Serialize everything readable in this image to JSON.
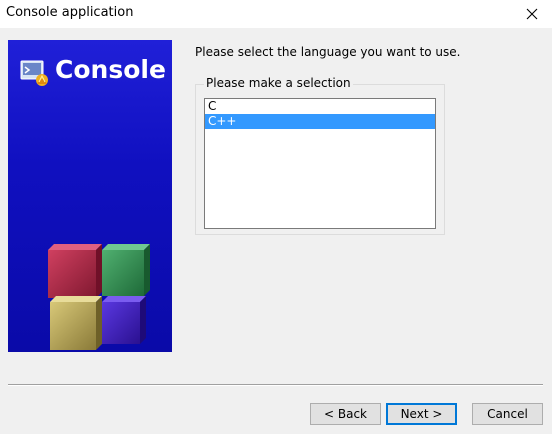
{
  "window": {
    "title": "Console application"
  },
  "banner": {
    "title": "Console",
    "colors": {
      "background": "#1414c8",
      "cube_red": "#a8203c",
      "cube_green": "#2e8a4a",
      "cube_yellow": "#b8a850",
      "cube_purple": "#3a1cc0"
    }
  },
  "prompt": "Please select the language you want to use.",
  "selection": {
    "group_label": "Please make a selection",
    "items": [
      {
        "label": "C",
        "selected": false
      },
      {
        "label": "C++",
        "selected": true
      }
    ]
  },
  "buttons": {
    "back_label": "< Back",
    "next_label": "Next >",
    "cancel_label": "Cancel"
  },
  "icons": {
    "close": "close-icon",
    "logo": "codeblocks-logo-icon"
  }
}
